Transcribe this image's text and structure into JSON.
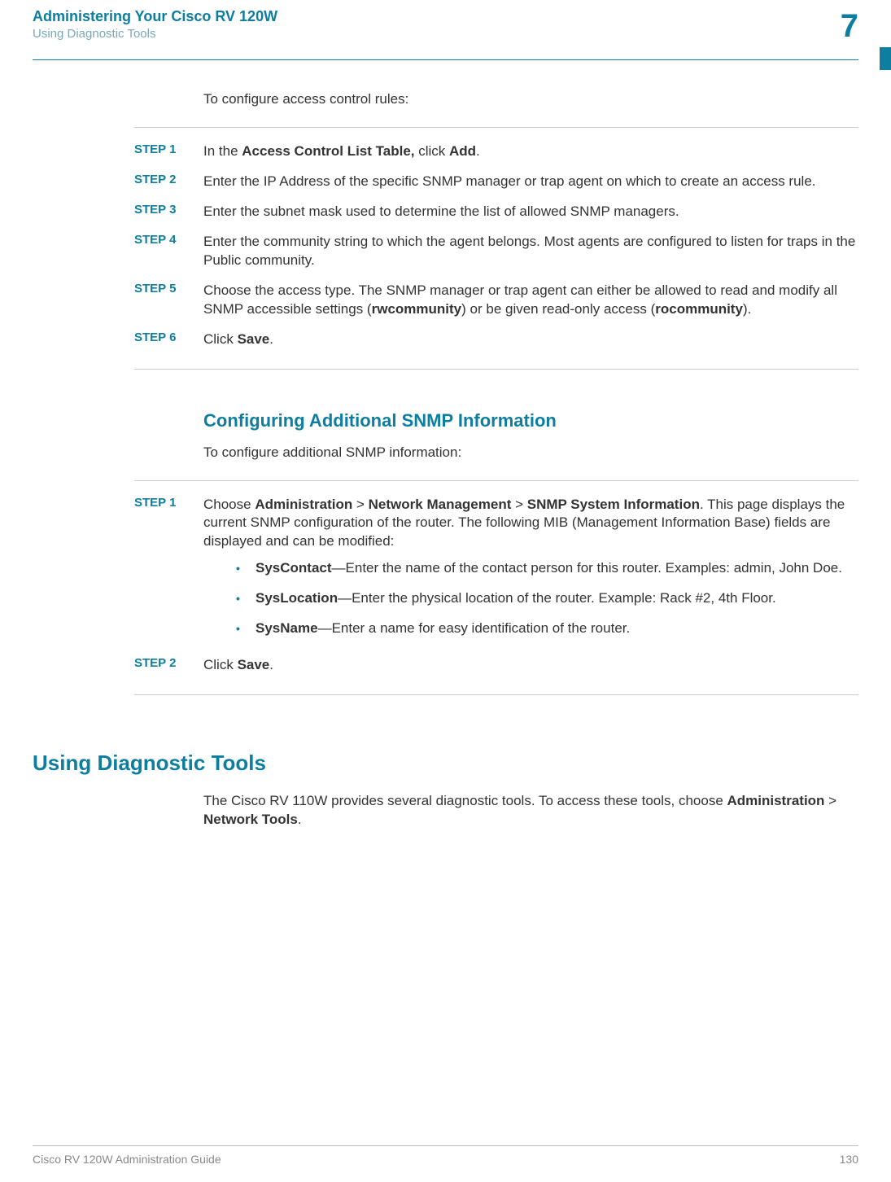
{
  "header": {
    "title": "Administering Your Cisco RV 120W",
    "subtitle": "Using Diagnostic Tools",
    "chapter_num": "7"
  },
  "section1": {
    "intro": "To configure access control rules:",
    "steps": [
      {
        "label": "STEP  1",
        "parts": [
          "In the ",
          "Access Control List Table,",
          " click ",
          "Add",
          "."
        ]
      },
      {
        "label": "STEP  2",
        "text": "Enter the IP Address of the specific SNMP manager or trap agent on which to create an access rule."
      },
      {
        "label": "STEP  3",
        "text": "Enter the subnet mask used to determine the list of allowed SNMP managers."
      },
      {
        "label": "STEP  4",
        "text": "Enter the community string to which the agent belongs. Most agents are configured to listen for traps in the Public community."
      },
      {
        "label": "STEP  5",
        "parts": [
          "Choose the access type. The SNMP manager or trap agent can either be allowed to read and modify all SNMP accessible settings (",
          "rwcommunity",
          ") or be given read-only access (",
          "rocommunity",
          ")."
        ]
      },
      {
        "label": "STEP  6",
        "parts": [
          "Click ",
          "Save",
          "."
        ]
      }
    ]
  },
  "section2": {
    "heading": "Configuring Additional SNMP Information",
    "intro": "To configure additional SNMP information:",
    "step1_label": "STEP  1",
    "step1_parts": [
      "Choose ",
      "Administration",
      " > ",
      "Network Management",
      " > ",
      "SNMP System Information",
      ". This page displays the current SNMP configuration of the router. The following MIB (Management Information Base) fields are displayed and can be modified:"
    ],
    "bullets": [
      {
        "bold": "SysContact",
        "rest": "—Enter the name of the contact person for this router. Examples: admin, John Doe."
      },
      {
        "bold": "SysLocation",
        "rest": "—Enter the physical location of the router. Example: Rack #2, 4th Floor."
      },
      {
        "bold": "SysName",
        "rest": "—Enter a name for easy identification of the router."
      }
    ],
    "step2_label": "STEP  2",
    "step2_parts": [
      "Click ",
      "Save",
      "."
    ]
  },
  "section3": {
    "heading": "Using Diagnostic Tools",
    "body_parts": [
      "The Cisco RV 110W provides several diagnostic tools. To access these tools, choose ",
      "Administration",
      " > ",
      "Network Tools",
      "."
    ]
  },
  "footer": {
    "left": "Cisco RV 120W Administration Guide",
    "right": "130"
  }
}
